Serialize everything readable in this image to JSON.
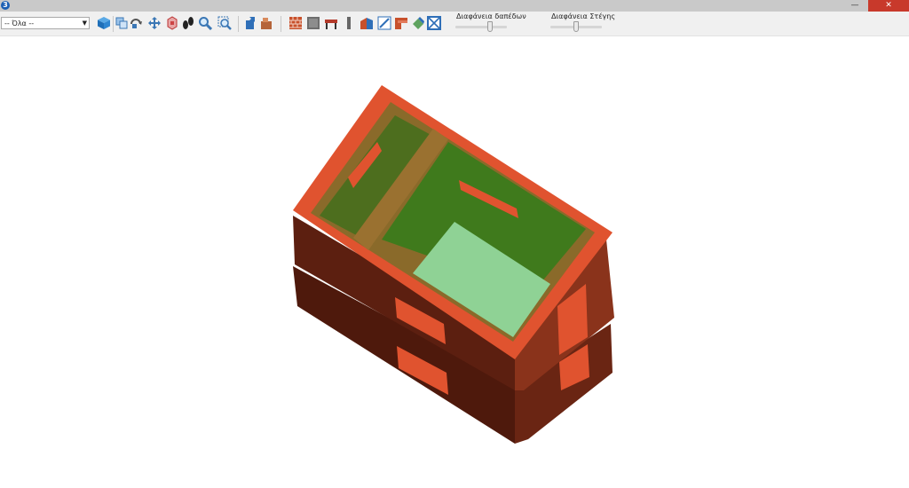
{
  "window": {
    "app_icon": "3",
    "minimize": "—",
    "restore": "❐",
    "close": "✕"
  },
  "toolbar": {
    "filter_value": "-- Όλα --",
    "icons": [
      "3d-view-icon",
      "copy-view-icon",
      "rotate-icon",
      "pan-icon",
      "select-icon",
      "walk-icon",
      "zoom-icon",
      "zoom-window-icon",
      "export-icon",
      "import-icon",
      "wall-icon",
      "slab-icon",
      "beam-icon",
      "column-icon",
      "stair-icon",
      "section-icon",
      "roof-icon",
      "fill-icon",
      "frame-icon"
    ]
  },
  "sliders": {
    "floor_label": "Διαφάνεια δαπέδων",
    "floor_value": 0.6,
    "roof_label": "Διαφάνεια Στέγης",
    "roof_value": 0.5
  },
  "colors": {
    "wall_top": "#e0532f",
    "wall_side_dark": "#5a1d0f",
    "inner_olive": "#8a6a2a",
    "floor_green": "#8fd295",
    "inner_green": "#4c7a1e"
  }
}
